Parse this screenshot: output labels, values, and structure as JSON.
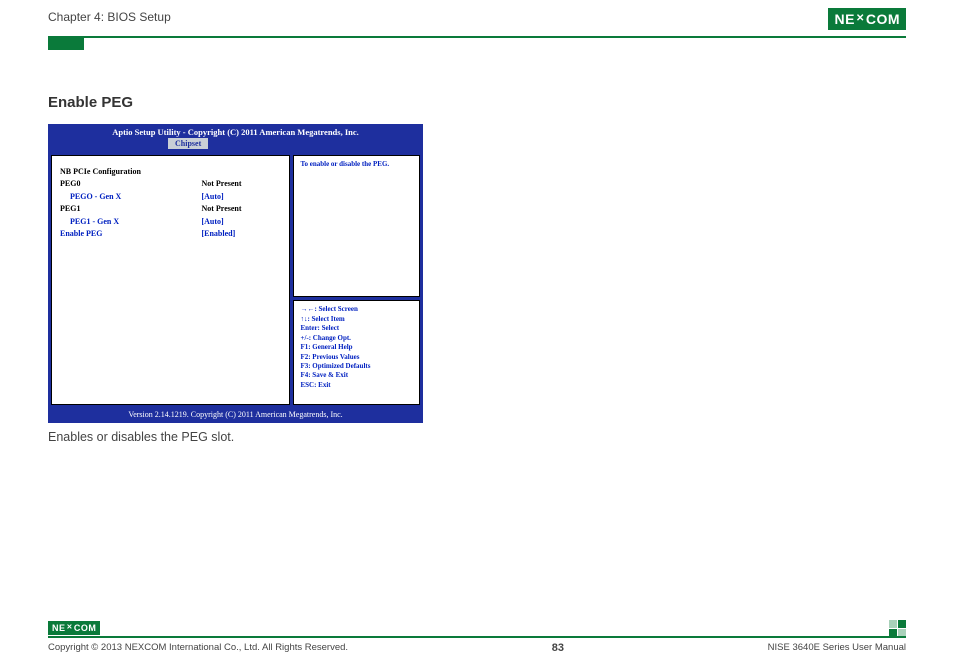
{
  "header": {
    "chapter": "Chapter 4: BIOS Setup",
    "logo_text_a": "NE",
    "logo_text_x": "✕",
    "logo_text_b": "COM"
  },
  "section": {
    "title": "Enable PEG",
    "caption": "Enables or disables the PEG slot."
  },
  "bios": {
    "title": "Aptio Setup Utility - Copyright (C) 2011 American Megatrends, Inc.",
    "tab": "Chipset",
    "footer": "Version 2.14.1219. Copyright (C) 2011 American Megatrends, Inc.",
    "help_text": "To enable or disable the PEG.",
    "rows": [
      {
        "label": "NB PCIe Configuration",
        "value": "",
        "blue": false,
        "indent": false
      },
      {
        "label": "PEG0",
        "value": "Not Present",
        "blue": false,
        "indent": false
      },
      {
        "label": "PEGO - Gen X",
        "value": "[Auto]",
        "blue": true,
        "indent": true
      },
      {
        "label": "PEG1",
        "value": "Not Present",
        "blue": false,
        "indent": false
      },
      {
        "label": "PEG1 - Gen X",
        "value": "[Auto]",
        "blue": true,
        "indent": true
      },
      {
        "label": "",
        "value": "",
        "blue": false,
        "indent": false
      },
      {
        "label": "Enable PEG",
        "value": "[Enabled]",
        "blue": true,
        "indent": false
      }
    ],
    "keys": [
      "→←: Select Screen",
      "↑↓: Select Item",
      "Enter: Select",
      "+/-: Change Opt.",
      "F1: General Help",
      "F2: Previous Values",
      "F3: Optimized Defaults",
      "F4: Save & Exit",
      "ESC: Exit"
    ]
  },
  "footer": {
    "copyright": "Copyright © 2013 NEXCOM International Co., Ltd. All Rights Reserved.",
    "page": "83",
    "manual": "NISE 3640E Series User Manual"
  }
}
